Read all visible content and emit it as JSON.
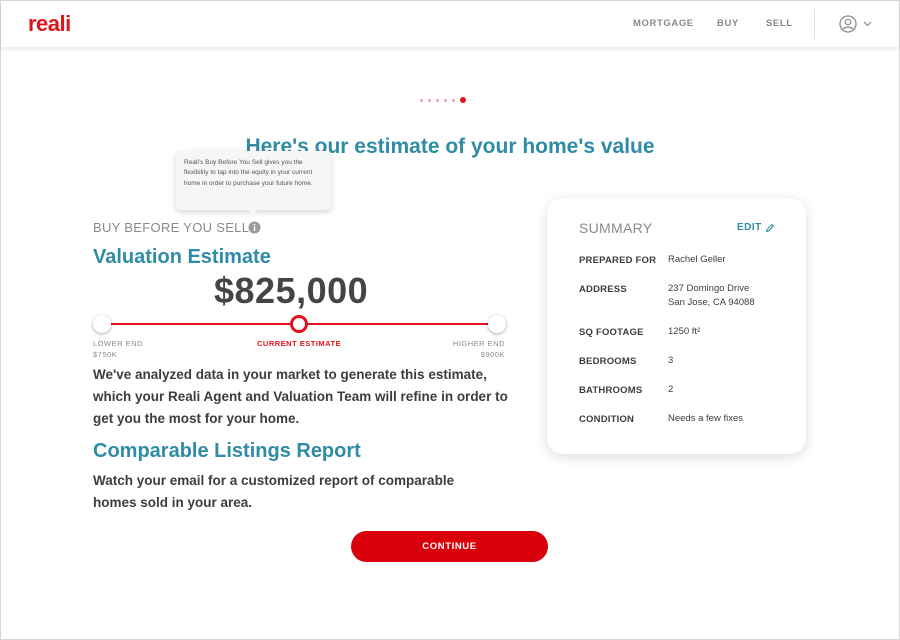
{
  "header": {
    "logo": "reali",
    "nav": [
      "MORTGAGE",
      "BUY",
      "SELL"
    ],
    "account_icon": "user-circle-icon",
    "dropdown_icon": "chevron-down-icon"
  },
  "progress": {
    "total_steps": 6,
    "current_step": 6
  },
  "page": {
    "headline": "Here's our estimate of your home's value",
    "tooltip": "Reali's Buy Before You Sell gives you the flexibility to tap into the equity in your current home in order to purchase your future home.",
    "section_label": "BUY BEFORE YOU SELL",
    "info_icon": "info-icon",
    "valuation_title": "Valuation Estimate",
    "amount": "$825,000",
    "slider": {
      "lower_label": "LOWER END",
      "lower_value": "$750K",
      "current_label": "CURRENT ESTIMATE",
      "higher_label": "HIGHER END",
      "higher_value": "$900K",
      "position_fraction": 0.5
    },
    "paragraph_1": "We've analyzed data in your market to generate this estimate, which your Reali Agent and Valuation Team will refine in order to get you the most for your home.",
    "comparable_title": "Comparable Listings Report",
    "paragraph_2": "Watch your email for a customized report of comparable homes sold in your area."
  },
  "summary": {
    "title": "SUMMARY",
    "edit_label": "EDIT",
    "edit_icon": "pencil-icon",
    "rows": [
      {
        "label": "PREPARED FOR",
        "value": "Rachel Geller"
      },
      {
        "label": "ADDRESS",
        "value_line1": "237 Domingo Drive",
        "value_line2": "San Jose, CA 94088"
      },
      {
        "label": "SQ FOOTAGE",
        "value": "1250 ft²"
      },
      {
        "label": "BEDROOMS",
        "value": "3"
      },
      {
        "label": "BATHROOMS",
        "value": "2"
      },
      {
        "label": "CONDITION",
        "value": "Needs a few fixes"
      }
    ]
  },
  "actions": {
    "continue_label": "CONTINUE"
  },
  "colors": {
    "brand_red": "#e0141c",
    "teal": "#2f8ca6",
    "button_red": "#d8000a"
  }
}
